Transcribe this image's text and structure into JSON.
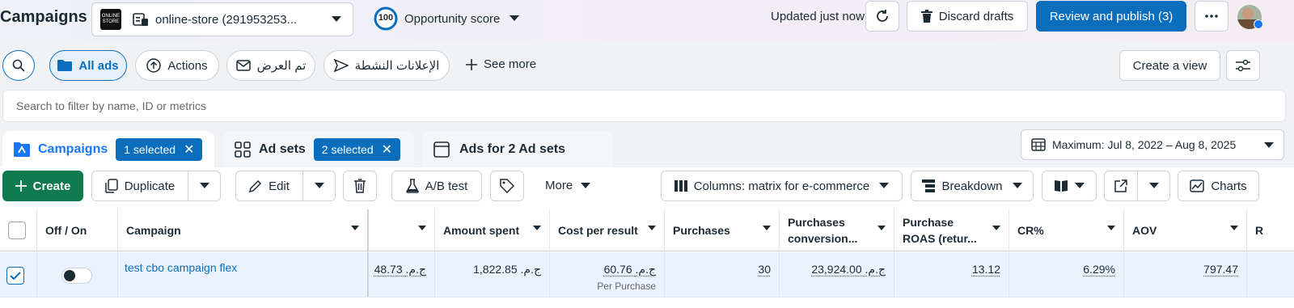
{
  "header": {
    "title": "Campaigns",
    "account_name": "online-store (291953253...",
    "opportunity_score": "100",
    "opportunity_label": "Opportunity score",
    "updated_text": "Updated just now",
    "discard_label": "Discard drafts",
    "review_label": "Review and publish (3)"
  },
  "filters": {
    "all_ads": "All ads",
    "actions": "Actions",
    "shown": "تم العرض",
    "active_ads": "الإعلانات النشطة",
    "see_more": "See more",
    "create_view": "Create a view",
    "search_placeholder": "Search to filter by name, ID or metrics"
  },
  "tabs": [
    {
      "label": "Campaigns",
      "badge": "1 selected"
    },
    {
      "label": "Ad sets",
      "badge": "2 selected"
    },
    {
      "label": "Ads for 2 Ad sets"
    }
  ],
  "date_range": "Maximum: Jul 8, 2022 – Aug 8, 2025",
  "actions": {
    "create": "Create",
    "duplicate": "Duplicate",
    "edit": "Edit",
    "ab_test": "A/B test",
    "more": "More",
    "columns": "Columns: matrix for e-commerce",
    "breakdown": "Breakdown",
    "charts": "Charts"
  },
  "table": {
    "headers": {
      "off_on": "Off / On",
      "campaign": "Campaign",
      "amount_spent": "Amount spent",
      "cost_per_result": "Cost per result",
      "purchases": "Purchases",
      "purchases_conv_1": "Purchases",
      "purchases_conv_2": "conversion...",
      "roas_1": "Purchase",
      "roas_2": "ROAS (retur...",
      "cr": "CR%",
      "aov": "AOV",
      "next": "R"
    },
    "row": {
      "campaign": "test cbo campaign flex",
      "col0": "48.73 ج.م.‏",
      "amount_spent": "1,822.85 ج.م.‏",
      "cost_per_result": "60.76 ج.م.‏",
      "cost_sub": "Per Purchase",
      "purchases": "30",
      "conversion": "23,924.00 ج.م.‏",
      "roas": "13.12",
      "cr": "6.29%",
      "aov": "797.47"
    }
  },
  "colors": {
    "primary": "#0a6ebd",
    "create": "#0f7a4d",
    "active_tab": "#1877f2"
  }
}
